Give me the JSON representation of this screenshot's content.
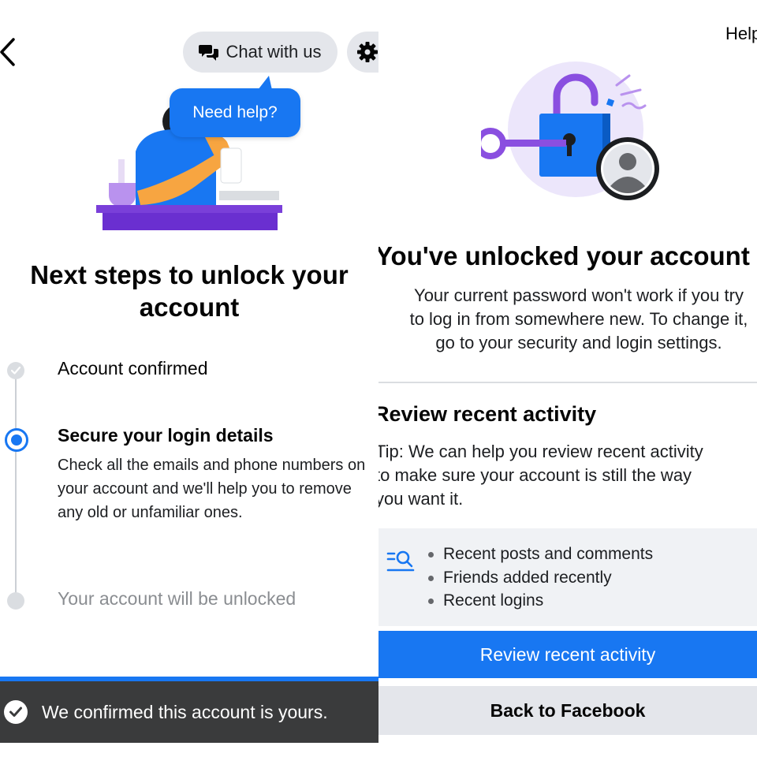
{
  "left": {
    "chat_label": "Chat with us",
    "help_bubble": "Need help?",
    "title": "Next steps to unlock your account",
    "steps": [
      {
        "label": "Account confirmed",
        "state": "done"
      },
      {
        "label": "Secure your login details",
        "state": "active",
        "description": "Check all the emails and phone numbers on your account and we'll help you to remove any old or unfamiliar ones."
      },
      {
        "label": "Your account will be unlocked",
        "state": "pending"
      }
    ],
    "toast": "We confirmed this account is yours."
  },
  "right": {
    "help_link": "Help",
    "title": "You've unlocked your account",
    "body_lines": [
      "Your current password won't work if you try",
      "to log in from somewhere new. To change it,",
      "go to your security and login settings."
    ],
    "review_heading": "Review recent activity",
    "tip_lines": [
      "Tip: We can help you review recent activity",
      "to make sure your account is still the way",
      "you want it."
    ],
    "activity_items": [
      "Recent posts and comments",
      "Friends added recently",
      "Recent logins"
    ],
    "primary_button": "Review recent activity",
    "secondary_button": "Back to Facebook"
  },
  "colors": {
    "accent": "#1877f2",
    "toast_bg": "#3a3b3c",
    "muted_text": "#8a8d91",
    "pill_bg": "#e4e6eb",
    "illustration_purple": "#8a4fe0"
  },
  "icons": {
    "back": "chevron-left-icon",
    "chat": "chat-bubbles-icon",
    "settings": "gear-icon",
    "toast": "check-circle-icon",
    "activity": "search-list-icon"
  }
}
